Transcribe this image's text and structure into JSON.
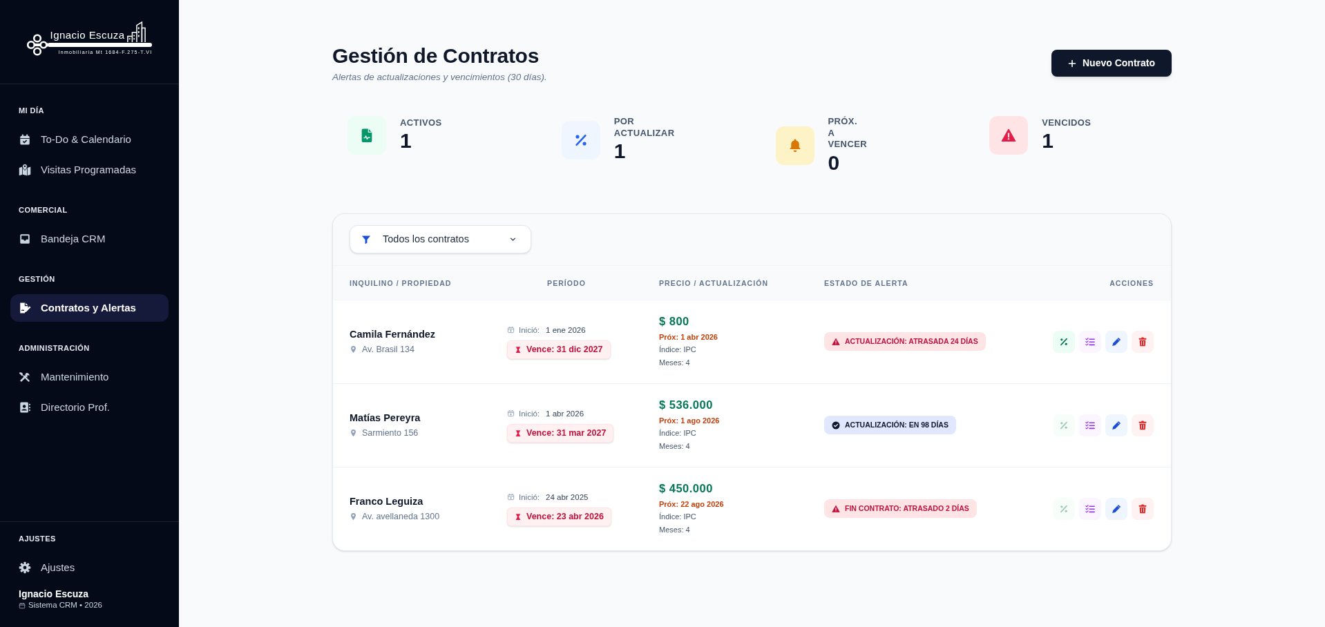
{
  "sidebar": {
    "logo": {
      "name": "Ignacio Escuza",
      "tagline": "Inmobiliaria Mt 1684-F.275-T.VI"
    },
    "sections": [
      {
        "title": "MI DÍA",
        "items": [
          {
            "label": "To-Do & Calendario",
            "selected": false
          },
          {
            "label": "Visitas Programadas",
            "selected": false
          }
        ]
      },
      {
        "title": "COMERCIAL",
        "items": [
          {
            "label": "Bandeja CRM",
            "selected": false
          }
        ]
      },
      {
        "title": "GESTIÓN",
        "items": [
          {
            "label": "Contratos y Alertas",
            "selected": true
          }
        ]
      },
      {
        "title": "ADMINISTRACIÓN",
        "items": [
          {
            "label": "Mantenimiento",
            "selected": false
          },
          {
            "label": "Directorio Prof.",
            "selected": false
          }
        ]
      }
    ],
    "settings": {
      "title": "AJUSTES",
      "items": [
        {
          "label": "Ajustes",
          "selected": false
        }
      ]
    },
    "user": {
      "name": "Ignacio Escuza",
      "subtitle": "Sistema CRM • 2026"
    }
  },
  "header": {
    "title": "Gestión de Contratos",
    "subtitle": "Alertas de actualizaciones y vencimientos (30 días).",
    "new_button": "Nuevo Contrato"
  },
  "stats": [
    {
      "kind": "active",
      "label": "ACTIVOS",
      "value": "1"
    },
    {
      "kind": "update",
      "label": "POR ACTUALIZAR",
      "value": "1"
    },
    {
      "kind": "expiring",
      "label": "PRÓX. A VENCER",
      "value": "0"
    },
    {
      "kind": "expired",
      "label": "VENCIDOS",
      "value": "1"
    }
  ],
  "filter": {
    "value": "Todos los contratos"
  },
  "table": {
    "columns": [
      "INQUILINO / PROPIEDAD",
      "PERÍODO",
      "PRECIO / ACTUALIZACIÓN",
      "ESTADO DE ALERTA",
      "ACCIONES"
    ],
    "rows": [
      {
        "tenant": "Camila Fernández",
        "address": "Av. Brasil 134",
        "start_label": "Inició:",
        "start_date": "1 ene 2026",
        "due": "Vence: 31 dic 2027",
        "price": "$ 800",
        "next_update": "Próx: 1 abr 2026",
        "index": "Índice: IPC",
        "months": "Meses: 4",
        "alert": {
          "kind": "warning",
          "text": "ACTUALIZACIÓN: ATRASADA 24 DÍAS"
        },
        "actions": [
          {
            "kind": "percent",
            "disabled": false
          },
          {
            "kind": "checklist",
            "disabled": false
          },
          {
            "kind": "edit",
            "disabled": false
          },
          {
            "kind": "delete",
            "disabled": false
          }
        ]
      },
      {
        "tenant": "Matías Pereyra",
        "address": "Sarmiento 156",
        "start_label": "Inició:",
        "start_date": "1 abr 2026",
        "due": "Vence: 31 mar 2027",
        "price": "$ 536.000",
        "next_update": "Próx: 1 ago 2026",
        "index": "Índice: IPC",
        "months": "Meses: 4",
        "alert": {
          "kind": "ok",
          "text": "ACTUALIZACIÓN: EN 98 DÍAS"
        },
        "actions": [
          {
            "kind": "percent",
            "disabled": true
          },
          {
            "kind": "checklist",
            "disabled": false
          },
          {
            "kind": "edit",
            "disabled": false
          },
          {
            "kind": "delete",
            "disabled": false
          }
        ]
      },
      {
        "tenant": "Franco Leguiza",
        "address": "Av. avellaneda 1300",
        "start_label": "Inició:",
        "start_date": "24 abr 2025",
        "due": "Vence: 23 abr 2026",
        "price": "$ 450.000",
        "next_update": "Próx: 22 ago 2026",
        "index": "Índice: IPC",
        "months": "Meses: 4",
        "alert": {
          "kind": "warning",
          "text": "FIN CONTRATO: ATRASADO 2 DÍAS"
        },
        "actions": [
          {
            "kind": "percent",
            "disabled": true
          },
          {
            "kind": "checklist",
            "disabled": false
          },
          {
            "kind": "edit",
            "disabled": false
          },
          {
            "kind": "delete",
            "disabled": false
          }
        ]
      }
    ]
  }
}
